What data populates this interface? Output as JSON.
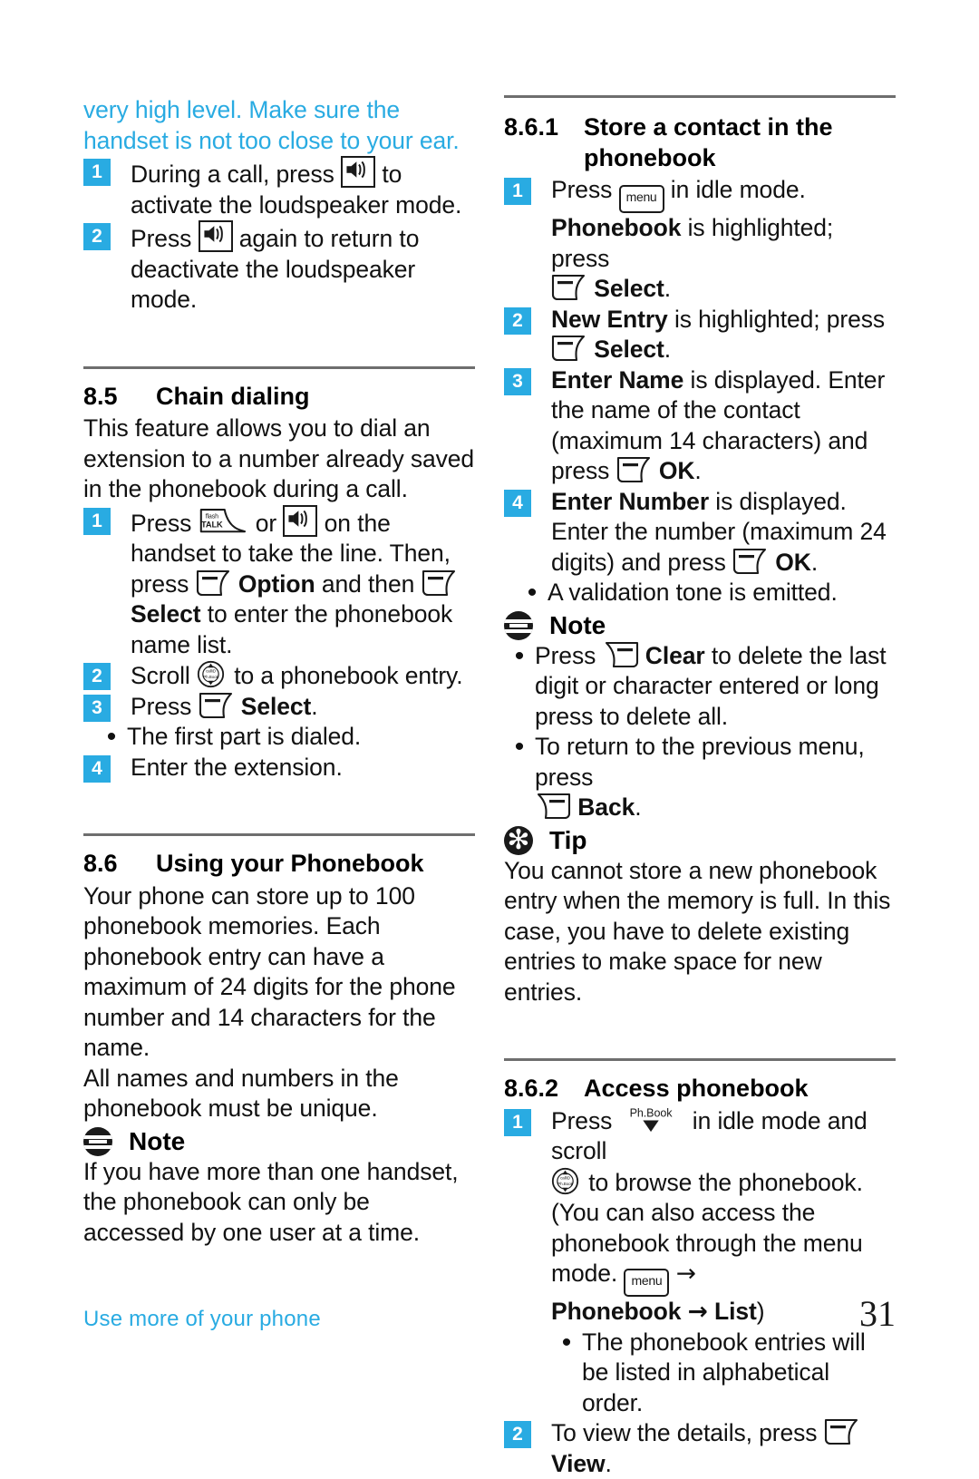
{
  "page": {
    "number": "31",
    "footer_label": "Use more of your phone",
    "accent_color": "#29abe2"
  },
  "left_column": {
    "warning_text": "very high level. Make sure the handset is not too close to your ear.",
    "loudspeaker_steps": [
      {
        "num": "1",
        "text_before": "During a call, press ",
        "icon": "loudspeaker-key-icon",
        "text_after": " to activate the loudspeaker mode."
      },
      {
        "num": "2",
        "text_before": "Press ",
        "icon": "loudspeaker-key-icon",
        "text_after": " again to return to deactivate the loudspeaker mode."
      }
    ],
    "section_85": {
      "number": "8.5",
      "title": "Chain dialing",
      "intro": "This feature allows you to dial an extension to a number already saved in the phonebook during a call.",
      "steps": [
        {
          "num": "1",
          "p1": "Press ",
          "icon1": "talk-key-icon",
          "p2": " or ",
          "icon2": "loudspeaker-key-icon",
          "p3": " on the handset to take the line. Then, press ",
          "icon3": "softkey-left-icon",
          "p4": " ",
          "bold1": "Option",
          "p5": " and then ",
          "icon4": "softkey-left-icon",
          "bold2": "Select",
          "p6": " to enter the phonebook name list."
        },
        {
          "num": "2",
          "p1": "Scroll ",
          "icon1": "nav-wheel-icon",
          "p2": " to a phonebook entry."
        },
        {
          "num": "3",
          "p1": "Press ",
          "icon1": "softkey-left-icon",
          "bold1": "Select",
          "p2": "."
        }
      ],
      "bullet": "The first part is dialed.",
      "last_step": {
        "num": "4",
        "text": "Enter the extension."
      }
    },
    "section_86": {
      "number": "8.6",
      "title": "Using your Phonebook",
      "para1": "Your phone can store up to 100 phonebook memories. Each phonebook entry can have a maximum of 24 digits for the phone number and 14 characters for the name.",
      "para2": "All names and numbers in the phonebook must be unique.",
      "note_label": "Note",
      "note_body": "If you have more than one handset, the phonebook can only be accessed by one user at a time."
    }
  },
  "right_column": {
    "section_861": {
      "number": "8.6.1",
      "title_line1": "Store a contact in the",
      "title_line2": "phonebook",
      "steps": [
        {
          "num": "1",
          "p1": "Press ",
          "icon1": "menu-key-icon",
          "p2": " in idle mode.",
          "bold1": "Phonebook",
          "p3": " is highlighted; press ",
          "icon2": "softkey-left-icon",
          "bold2": "Select",
          "p4": "."
        },
        {
          "num": "2",
          "bold1": "New Entry",
          "p1": " is highlighted; press ",
          "icon1": "softkey-left-icon",
          "bold2": "Select",
          "p2": "."
        },
        {
          "num": "3",
          "bold1": "Enter Name",
          "p1": " is displayed. Enter the name of the contact (maximum 14 characters) and press ",
          "icon1": "softkey-left-icon",
          "bold2": "OK",
          "p2": "."
        },
        {
          "num": "4",
          "bold1": "Enter Number",
          "p1": " is displayed. Enter the number (maximum 24 digits) and press ",
          "icon1": "softkey-left-icon",
          "bold2": "OK",
          "p2": "."
        }
      ],
      "bullet": "A validation tone is emitted.",
      "note_label": "Note",
      "note_bullets": [
        {
          "p1": "Press ",
          "icon1": "softkey-right-icon",
          "bold1": "Clear",
          "p2": " to delete the last digit or character entered or long press to delete all."
        },
        {
          "p1": "To return to the previous menu, press ",
          "icon1": "softkey-right-icon",
          "bold1": "Back",
          "p2": "."
        }
      ],
      "tip_label": "Tip",
      "tip_body": "You cannot store a new phonebook entry when the memory is full. In this case, you have to delete existing entries to make space for new entries."
    },
    "section_862": {
      "number": "8.6.2",
      "title": "Access phonebook",
      "step1": {
        "num": "1",
        "p1": "Press ",
        "icon1": "phonebook-down-key-icon",
        "p2": " in idle mode and scroll ",
        "icon2": "nav-wheel-icon",
        "p3": " to browse the phonebook. (You can also access the phonebook through the menu mode. ",
        "icon3": "menu-key-icon",
        "p4": " ",
        "arrow1": "→",
        "p5": " ",
        "bold1": "Phonebook",
        "arrow2": "→",
        "bold2": "List",
        "p6": ")"
      },
      "bullet": "The phonebook entries will be listed in alphabetical order.",
      "step2": {
        "num": "2",
        "p1": "To view the details, press ",
        "icon1": "softkey-left-icon",
        "bold1": "View",
        "p2": "."
      }
    }
  },
  "icons": {
    "menu_key_label": "menu",
    "talk_key_label_top": "flash",
    "talk_key_label_bottom": "TALK",
    "nav_label_top": "callID",
    "nav_label_bottom": "Ph.Book",
    "phbook_label": "Ph.Book",
    "tip_glyph": "✻"
  }
}
